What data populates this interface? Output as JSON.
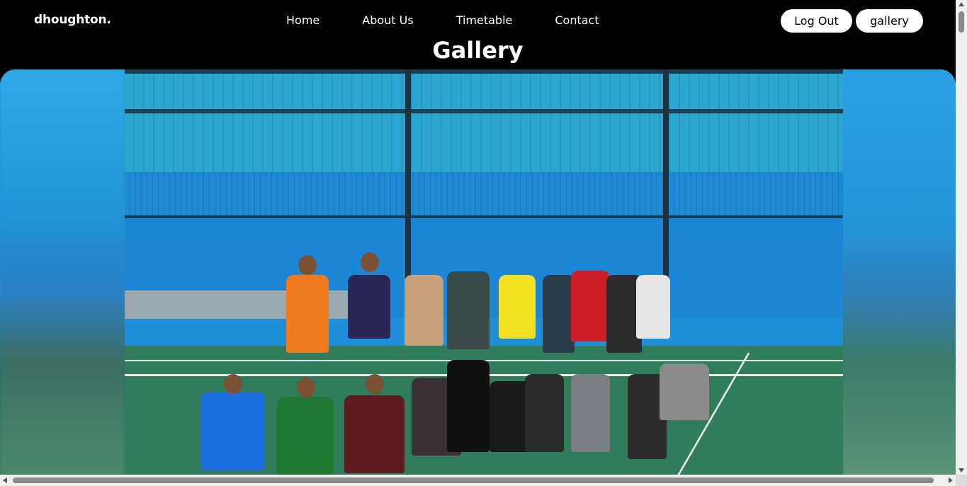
{
  "brand": {
    "name": "dhoughton."
  },
  "nav": {
    "links": [
      "Home",
      "About Us",
      "Timetable",
      "Contact"
    ]
  },
  "auth": {
    "logout_label": "Log Out",
    "gallery_label": "gallery"
  },
  "page": {
    "title": "Gallery"
  },
  "photo": {
    "subject": "group-photo"
  },
  "colors": {
    "header_bg": "#000000",
    "pill_bg": "#ffffff",
    "page_text": "#ffffff"
  }
}
